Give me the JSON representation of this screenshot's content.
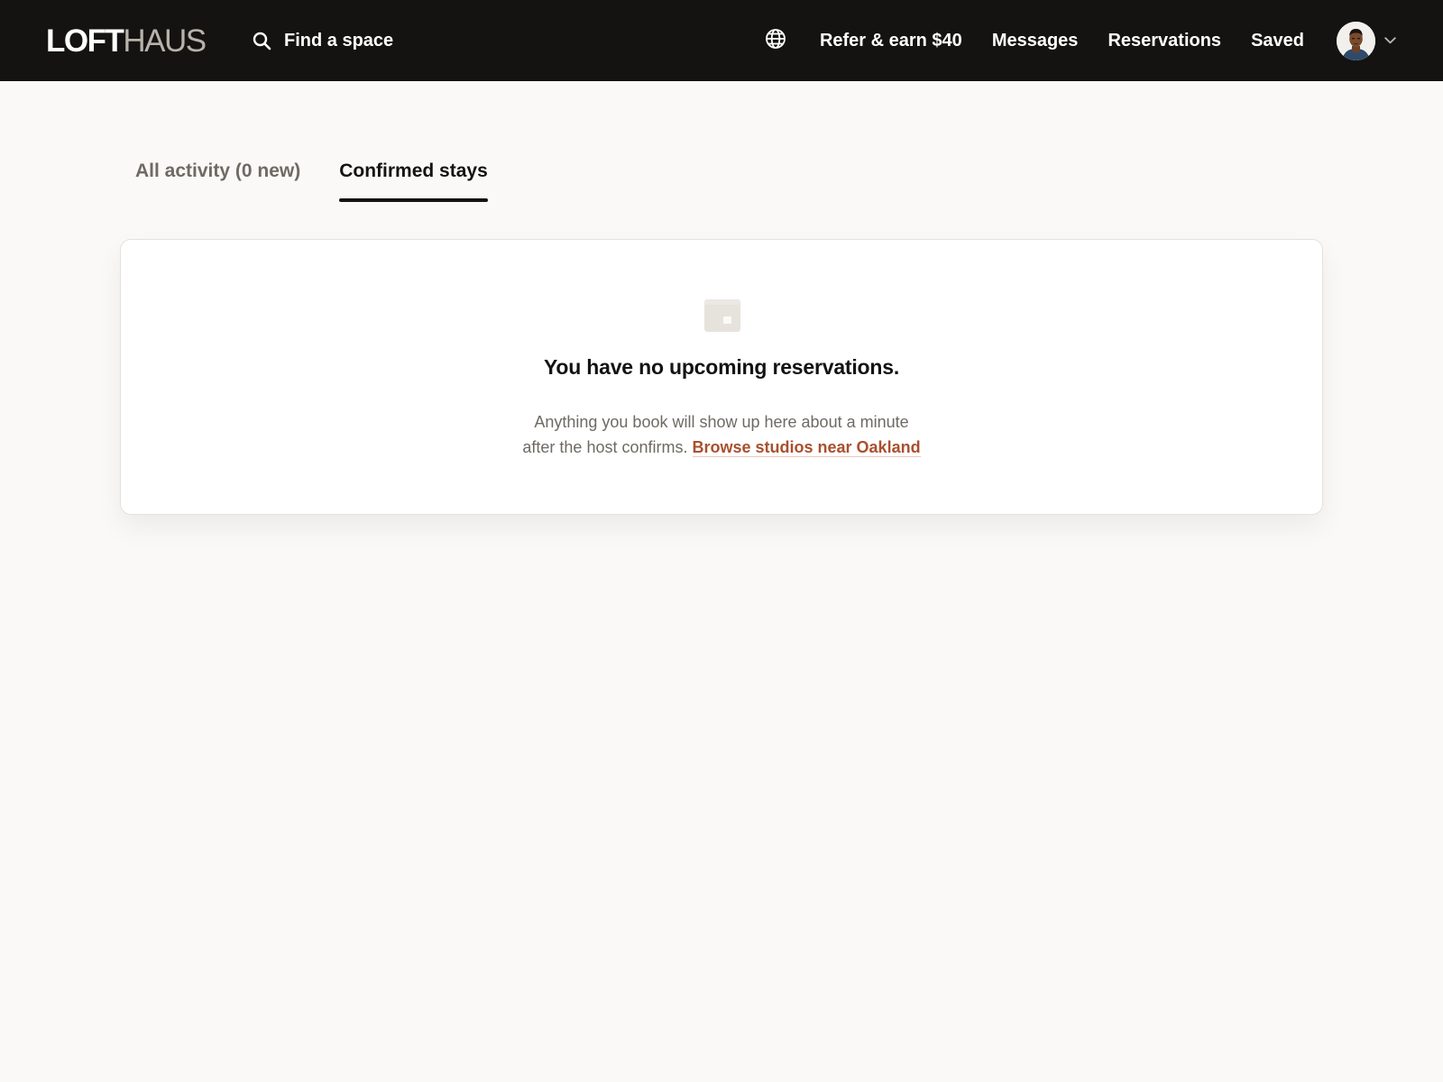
{
  "brand": {
    "logo_part1": "LOFT",
    "logo_part2": "HAUS"
  },
  "header": {
    "search_label": "Find a space",
    "search_icon": "search-icon",
    "language_icon": "globe-icon",
    "nav_links": [
      {
        "label": "Refer & earn $40"
      },
      {
        "label": "Messages"
      },
      {
        "label": "Reservations"
      },
      {
        "label": "Saved"
      }
    ],
    "profile_chevron_icon": "chevron-down-icon"
  },
  "tabs": [
    {
      "label": "All activity (0 new)",
      "active": false
    },
    {
      "label": "Confirmed stays",
      "active": true
    }
  ],
  "empty_state": {
    "icon": "empty-box-icon",
    "title": "You have no upcoming reservations.",
    "body_line1": "Anything you book will show up here about a minute",
    "body_line2": "after the host confirms.",
    "link_label": "Browse studios near Oakland"
  },
  "colors": {
    "nav_background": "#141311",
    "page_background": "#faf9f7",
    "link_accent": "#a9502e",
    "muted_text": "#6e6a64"
  }
}
